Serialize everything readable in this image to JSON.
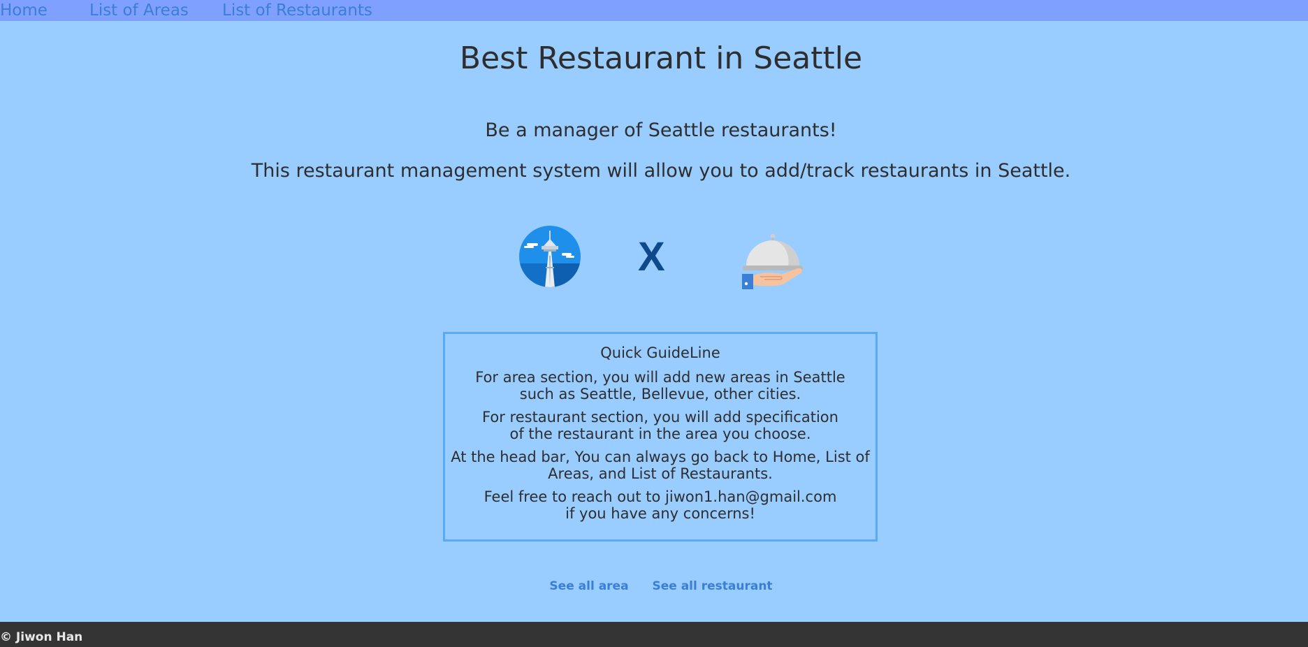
{
  "nav": {
    "items": [
      {
        "label": "Home"
      },
      {
        "label": "List of Areas"
      },
      {
        "label": "List of Restaurants"
      }
    ]
  },
  "main": {
    "title": "Best Restaurant in Seattle",
    "subtitle1": "Be a manager of Seattle restaurants!",
    "subtitle2": "This restaurant management system will allow you to add/track restaurants in Seattle.",
    "separator": "X",
    "icons": {
      "left": "space-needle-icon",
      "right": "serving-cloche-icon"
    }
  },
  "guide": {
    "title": "Quick GuideLine",
    "paragraphs": [
      "For area section, you will add new areas in Seattle\nsuch as Seattle, Bellevue, other cities.",
      "For restaurant section, you will add specification\nof the restaurant in the area you choose.",
      "At the head bar, You can always go back to Home, List of\nAreas, and List of Restaurants.",
      "Feel free to reach out to jiwon1.han@gmail.com\nif you have any concerns!"
    ]
  },
  "links": {
    "see_all_area": "See all area",
    "see_all_restaurant": "See all restaurant"
  },
  "footer": {
    "copyright": "© Jiwon Han"
  },
  "colors": {
    "background": "#99ccff",
    "navbar": "#80a0ff",
    "link": "#3a7fd5",
    "footer": "#343434",
    "box_border": "#5aa9f5"
  }
}
